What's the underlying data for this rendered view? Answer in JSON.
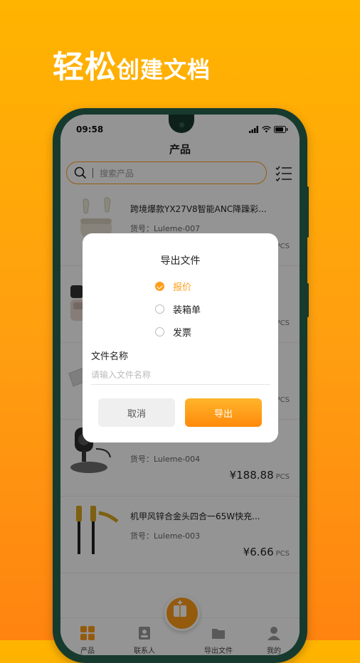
{
  "promo": {
    "headline_big": "轻松",
    "headline_small": "创建文档"
  },
  "status_bar": {
    "time": "09:58"
  },
  "header": {
    "title": "产品"
  },
  "search": {
    "placeholder": "搜索产品"
  },
  "products": [
    {
      "name": "跨境爆款YX27V8智能ANC降躁彩...",
      "sku": "货号：Luleme-007",
      "price": "",
      "unit": "PCS"
    },
    {
      "name": "",
      "sku": "",
      "price": "",
      "unit": "PCS"
    },
    {
      "name": "",
      "sku": "",
      "price": "",
      "unit": "PCS"
    },
    {
      "name": "",
      "sku": "货号：Luleme-004",
      "price": "¥188.88",
      "unit": "PCS"
    },
    {
      "name": "机甲风锌合金头四合一65W快充...",
      "sku": "货号：Luleme-003",
      "price": "¥6.66",
      "unit": "PCS"
    }
  ],
  "tabbar": [
    {
      "label": "产品",
      "icon": "grid-icon",
      "active": true
    },
    {
      "label": "联系人",
      "icon": "contact-icon",
      "active": false
    },
    {
      "label": "导出文件",
      "icon": "export-icon",
      "active": false
    },
    {
      "label": "我的",
      "icon": "user-icon",
      "active": false
    }
  ],
  "dialog": {
    "title": "导出文件",
    "options": [
      {
        "label": "报价",
        "selected": true
      },
      {
        "label": "装箱单",
        "selected": false
      },
      {
        "label": "发票",
        "selected": false
      }
    ],
    "file_name_label": "文件名称",
    "file_name_placeholder": "请输入文件名称",
    "file_name_value": "",
    "cancel_label": "取消",
    "export_label": "导出"
  },
  "colors": {
    "accent": "#FF9E1B",
    "background_top": "#FFB400",
    "background_bottom": "#FF8410",
    "phone_frame": "#173A2E"
  }
}
